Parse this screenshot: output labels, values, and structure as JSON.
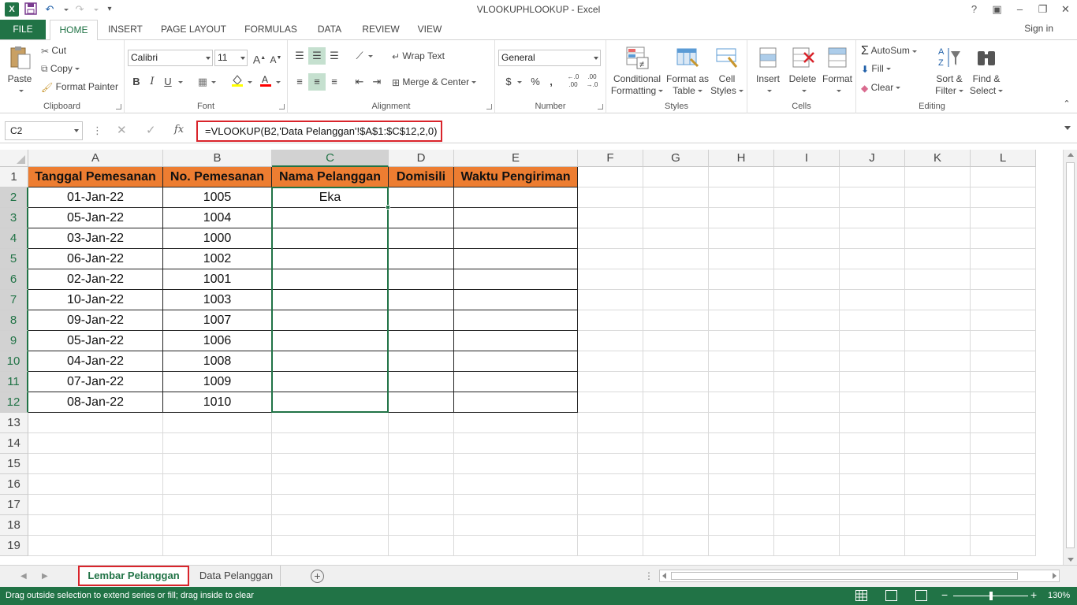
{
  "app": {
    "title": "VLOOKUPHLOOKUP - Excel",
    "signin": "Sign in",
    "help": "?",
    "window_buttons": [
      "restore-ribbon",
      "minimize",
      "maximize",
      "close"
    ]
  },
  "ribbon_tabs": [
    "FILE",
    "HOME",
    "INSERT",
    "PAGE LAYOUT",
    "FORMULAS",
    "DATA",
    "REVIEW",
    "VIEW"
  ],
  "ribbon": {
    "clipboard": {
      "label": "Clipboard",
      "paste": "Paste",
      "cut": "Cut",
      "copy": "Copy",
      "format_painter": "Format Painter"
    },
    "font": {
      "label": "Font",
      "name": "Calibri",
      "size": "11",
      "bold": "B",
      "italic": "I",
      "underline": "U"
    },
    "alignment": {
      "label": "Alignment",
      "wrap_text": "Wrap Text",
      "merge_center": "Merge & Center"
    },
    "number": {
      "label": "Number",
      "format": "General",
      "currency": "$",
      "percent": "%",
      "comma": ",",
      "inc_decimal": "←.0 .00",
      "dec_decimal": ".00 →.0"
    },
    "styles": {
      "label": "Styles",
      "conditional": "Conditional",
      "formatting": "Formatting",
      "format_as": "Format as",
      "table": "Table",
      "cell": "Cell",
      "styles_lbl": "Styles"
    },
    "cells": {
      "label": "Cells",
      "insert": "Insert",
      "delete": "Delete",
      "format": "Format"
    },
    "editing": {
      "label": "Editing",
      "autosum": "AutoSum",
      "fill": "Fill",
      "clear": "Clear",
      "sort": "Sort &",
      "filter": "Filter",
      "find": "Find &",
      "select": "Select"
    }
  },
  "formula_bar": {
    "name_box": "C2",
    "fx": "fx",
    "formula": "=VLOOKUP(B2,'Data Pelanggan'!$A$1:$C$12,2,0)"
  },
  "grid": {
    "columns": [
      "A",
      "B",
      "C",
      "D",
      "E",
      "F",
      "G",
      "H",
      "I",
      "J",
      "K",
      "L"
    ],
    "rows": [
      "1",
      "2",
      "3",
      "4",
      "5",
      "6",
      "7",
      "8",
      "9",
      "10",
      "11",
      "12",
      "13",
      "14",
      "15",
      "16",
      "17",
      "18",
      "19"
    ],
    "headers": [
      "Tanggal Pemesanan",
      "No. Pemesanan",
      "Nama Pelanggan",
      "Domisili",
      "Waktu Pengiriman"
    ],
    "data": [
      [
        "01-Jan-22",
        "1005",
        "Eka",
        "",
        ""
      ],
      [
        "05-Jan-22",
        "1004",
        "",
        "",
        ""
      ],
      [
        "03-Jan-22",
        "1000",
        "",
        "",
        ""
      ],
      [
        "06-Jan-22",
        "1002",
        "",
        "",
        ""
      ],
      [
        "02-Jan-22",
        "1001",
        "",
        "",
        ""
      ],
      [
        "10-Jan-22",
        "1003",
        "",
        "",
        ""
      ],
      [
        "09-Jan-22",
        "1007",
        "",
        "",
        ""
      ],
      [
        "05-Jan-22",
        "1006",
        "",
        "",
        ""
      ],
      [
        "04-Jan-22",
        "1008",
        "",
        "",
        ""
      ],
      [
        "07-Jan-22",
        "1009",
        "",
        "",
        ""
      ],
      [
        "08-Jan-22",
        "1010",
        "",
        "",
        ""
      ]
    ],
    "selected_cell": "C2",
    "selected_range": "C2:C12",
    "header_fill": "#ED7D31"
  },
  "sheets": {
    "tabs": [
      "Lembar Pelanggan",
      "Data Pelanggan"
    ],
    "active": "Lembar Pelanggan"
  },
  "status": {
    "message": "Drag outside selection to extend series or fill; drag inside to clear",
    "zoom": "130%"
  },
  "colors": {
    "accent": "#217346",
    "highlight": "#D9242B"
  }
}
